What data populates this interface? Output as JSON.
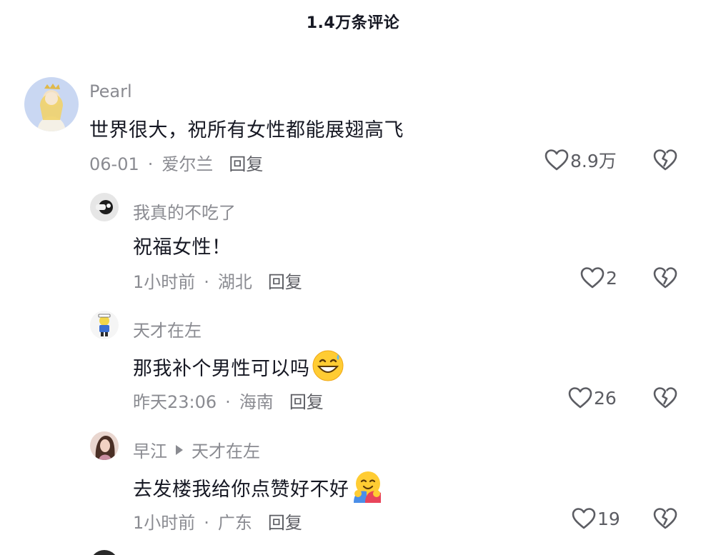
{
  "header": {
    "title": "1.4万条评论"
  },
  "comments": [
    {
      "author": "Pearl",
      "text": "世界很大，祝所有女性都能展翅高飞",
      "date": "06-01",
      "location": "爱尔兰",
      "reply_label": "回复",
      "likes": "8.9万",
      "avatar_icon": "illustrated-character-avatar"
    },
    {
      "author": "我真的不吃了",
      "text": "祝福女性！",
      "date": "1小时前",
      "location": "湖北",
      "reply_label": "回复",
      "likes": "2",
      "avatar_icon": "photo-avatar"
    },
    {
      "author": "天才在左",
      "text": "那我补个男性可以吗",
      "emoji": "grinning-sweat-emoji",
      "date": "昨天23:06",
      "location": "海南",
      "reply_label": "回复",
      "likes": "26",
      "avatar_icon": "cartoon-character-avatar"
    },
    {
      "author": "早江",
      "reply_to": "天才在左",
      "text": "去发楼我给你点赞好不好",
      "emoji": "hugging-emoji",
      "date": "1小时前",
      "location": "广东",
      "reply_label": "回复",
      "likes": "19",
      "avatar_icon": "portrait-avatar"
    }
  ],
  "separator": "·",
  "colors": {
    "primary_text": "#161823",
    "secondary_text": "#8a8b91",
    "action_text": "#5c5d63"
  }
}
